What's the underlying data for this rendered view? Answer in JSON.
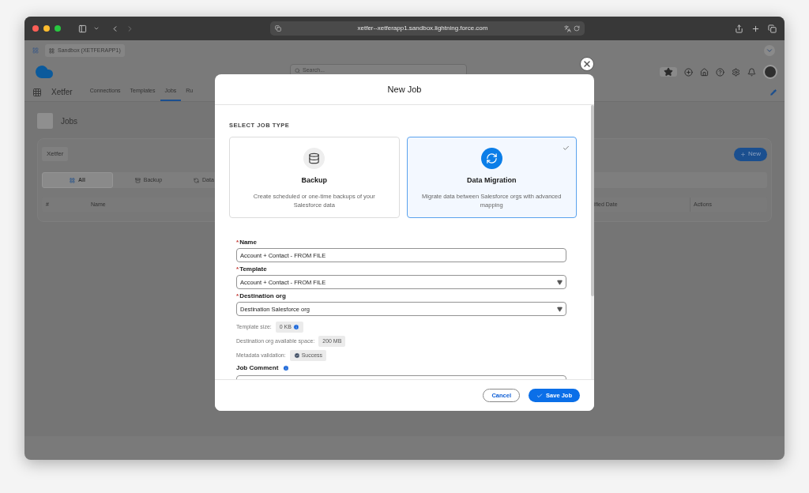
{
  "browser": {
    "url": "xetfer--xetferapp1.sandbox.lightning.force.com"
  },
  "app": {
    "sandbox_tab": "Sandbox (XETFERAPP1)",
    "search_placeholder": "Search...",
    "app_name": "Xetfer",
    "nav": [
      {
        "label": "Connections",
        "selected": false
      },
      {
        "label": "Templates",
        "selected": false
      },
      {
        "label": "Jobs",
        "selected": true
      },
      {
        "label": "Ru",
        "selected": false
      }
    ],
    "page_title": "Jobs",
    "card_badge": "Xetfer",
    "new_button": "New",
    "filters": [
      {
        "label": "All",
        "selected": true
      },
      {
        "label": "Backup",
        "selected": false
      },
      {
        "label": "Data",
        "selected": false
      }
    ],
    "columns": [
      "#",
      "Name",
      "ified Date",
      "Actions"
    ]
  },
  "modal": {
    "title": "New Job",
    "section_label": "SELECT JOB TYPE",
    "job_types": [
      {
        "kind": "backup",
        "title": "Backup",
        "description": "Create scheduled or one-time backups of your Salesforce data",
        "selected": false
      },
      {
        "kind": "migration",
        "title": "Data Migration",
        "description": "Migrate data between Salesforce orgs with advanced mapping",
        "selected": true
      }
    ],
    "fields": [
      {
        "kind": "text",
        "label": "Name",
        "required_mark": "*",
        "value": "Account + Contact - FROM FILE"
      },
      {
        "kind": "select",
        "label": "Template",
        "required_mark": "*",
        "value": "Account + Contact - FROM FILE"
      },
      {
        "kind": "select",
        "label": "Destination org",
        "required_mark": "*",
        "value": "Destination Salesforce org"
      }
    ],
    "info": [
      {
        "kind": "info",
        "label": "Template size:",
        "value": "0 KB"
      },
      {
        "kind": "plain",
        "label": "Destination org available space:",
        "value": "200 MB"
      },
      {
        "kind": "success",
        "label": "Metadata validation:",
        "value": "Success"
      }
    ],
    "comment_label": "Job Comment",
    "cancel": "Cancel",
    "save": "Save Job"
  }
}
